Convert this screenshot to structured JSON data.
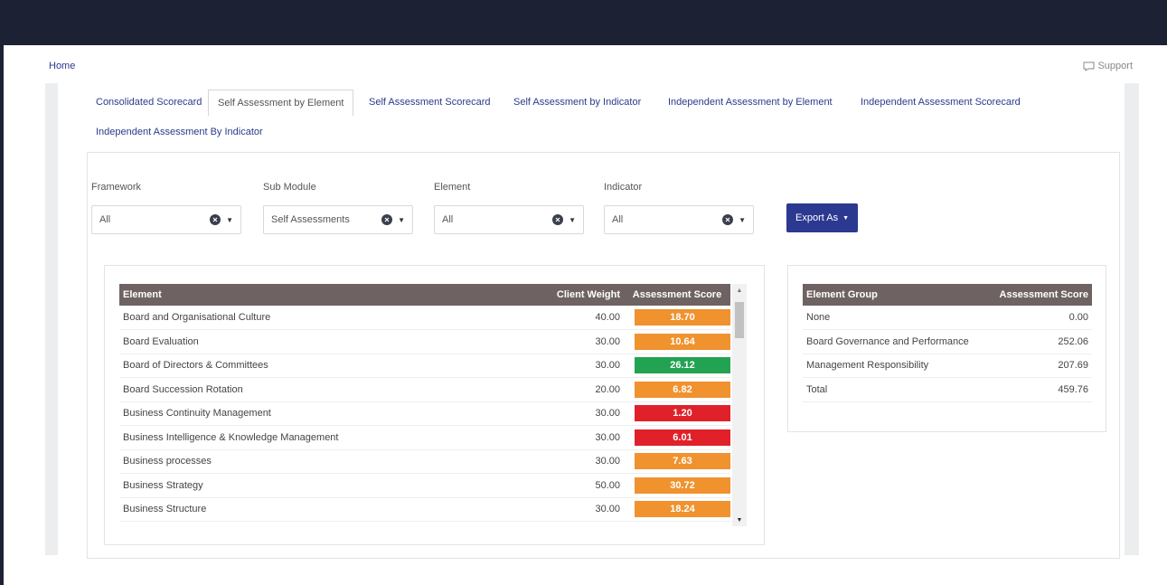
{
  "topbar": {
    "home": "Home",
    "support": "Support"
  },
  "tabs": [
    {
      "label": "Consolidated Scorecard",
      "active": false
    },
    {
      "label": "Self Assessment by Element",
      "active": true
    },
    {
      "label": "Self Assessment Scorecard",
      "active": false
    },
    {
      "label": "Self Assessment by Indicator",
      "active": false
    },
    {
      "label": "Independent Assessment by Element",
      "active": false
    },
    {
      "label": "Independent Assessment Scorecard",
      "active": false
    },
    {
      "label": "Independent Assessment By Indicator",
      "active": false
    }
  ],
  "filters": [
    {
      "label": "Framework",
      "value": "All"
    },
    {
      "label": "Sub Module",
      "value": "Self Assessments"
    },
    {
      "label": "Element",
      "value": "All"
    },
    {
      "label": "Indicator",
      "value": "All"
    }
  ],
  "export_label": "Export As",
  "element_table": {
    "headers": {
      "element": "Element",
      "weight": "Client Weight",
      "score": "Assessment Score"
    },
    "rows": [
      {
        "element": "Board and Organisational Culture",
        "weight": "40.00",
        "score": "18.70",
        "color": "#f0922e"
      },
      {
        "element": "Board Evaluation",
        "weight": "30.00",
        "score": "10.64",
        "color": "#f0922e"
      },
      {
        "element": "Board of Directors & Committees",
        "weight": "30.00",
        "score": "26.12",
        "color": "#22a352"
      },
      {
        "element": "Board Succession Rotation",
        "weight": "20.00",
        "score": "6.82",
        "color": "#f0922e"
      },
      {
        "element": "Business Continuity Management",
        "weight": "30.00",
        "score": "1.20",
        "color": "#e0212a"
      },
      {
        "element": "Business Intelligence & Knowledge Management",
        "weight": "30.00",
        "score": "6.01",
        "color": "#e0212a"
      },
      {
        "element": "Business processes",
        "weight": "30.00",
        "score": "7.63",
        "color": "#f0922e"
      },
      {
        "element": "Business Strategy",
        "weight": "50.00",
        "score": "30.72",
        "color": "#f0922e"
      },
      {
        "element": "Business Structure",
        "weight": "30.00",
        "score": "18.24",
        "color": "#f0922e"
      }
    ]
  },
  "group_table": {
    "headers": {
      "group": "Element Group",
      "score": "Assessment Score"
    },
    "rows": [
      {
        "group": "None",
        "score": "0.00"
      },
      {
        "group": "Board Governance and Performance",
        "score": "252.06"
      },
      {
        "group": "Management Responsibility",
        "score": "207.69"
      },
      {
        "group": "Total",
        "score": "459.76"
      }
    ]
  },
  "colors": {
    "header_bg": "#1c2133",
    "accent": "#2b3990",
    "table_header": "#6e6362",
    "orange": "#f0922e",
    "green": "#22a352",
    "red": "#e0212a"
  }
}
